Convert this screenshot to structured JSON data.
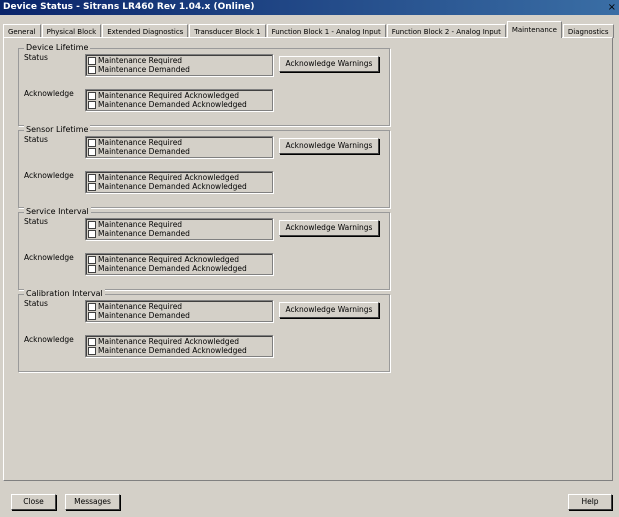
{
  "window": {
    "title": "Device Status - Sitrans LR460 Rev 1.04.x (Online)",
    "close_glyph": "×"
  },
  "tabs": [
    {
      "label": "General"
    },
    {
      "label": "Physical Block"
    },
    {
      "label": "Extended Diagnostics"
    },
    {
      "label": "Transducer Block 1"
    },
    {
      "label": "Function Block 1 - Analog Input"
    },
    {
      "label": "Function Block 2 - Analog Input"
    },
    {
      "label": "Maintenance",
      "active": true
    },
    {
      "label": "Diagnostics"
    }
  ],
  "groups": [
    {
      "title": "Device Lifetime",
      "status_label": "Status",
      "status_items": [
        "Maintenance Required",
        "Maintenance Demanded"
      ],
      "ack_label": "Acknowledge",
      "ack_items": [
        "Maintenance Required Acknowledged",
        "Maintenance Demanded Acknowledged"
      ],
      "button": "Acknowledge Warnings"
    },
    {
      "title": "Sensor Lifetime",
      "status_label": "Status",
      "status_items": [
        "Maintenance Required",
        "Maintenance Demanded"
      ],
      "ack_label": "Acknowledge",
      "ack_items": [
        "Maintenance Required Acknowledged",
        "Maintenance Demanded Acknowledged"
      ],
      "button": "Acknowledge Warnings"
    },
    {
      "title": "Service Interval",
      "status_label": "Status",
      "status_items": [
        "Maintenance Required",
        "Maintenance Demanded"
      ],
      "ack_label": "Acknowledge",
      "ack_items": [
        "Maintenance Required Acknowledged",
        "Maintenance Demanded Acknowledged"
      ],
      "button": "Acknowledge Warnings"
    },
    {
      "title": "Calibration Interval",
      "status_label": "Status",
      "status_items": [
        "Maintenance Required",
        "Maintenance Demanded"
      ],
      "ack_label": "Acknowledge",
      "ack_items": [
        "Maintenance Required Acknowledged",
        "Maintenance Demanded Acknowledged"
      ],
      "button": "Acknowledge Warnings"
    }
  ],
  "footer": {
    "close": "Close",
    "messages": "Messages",
    "help": "Help"
  }
}
